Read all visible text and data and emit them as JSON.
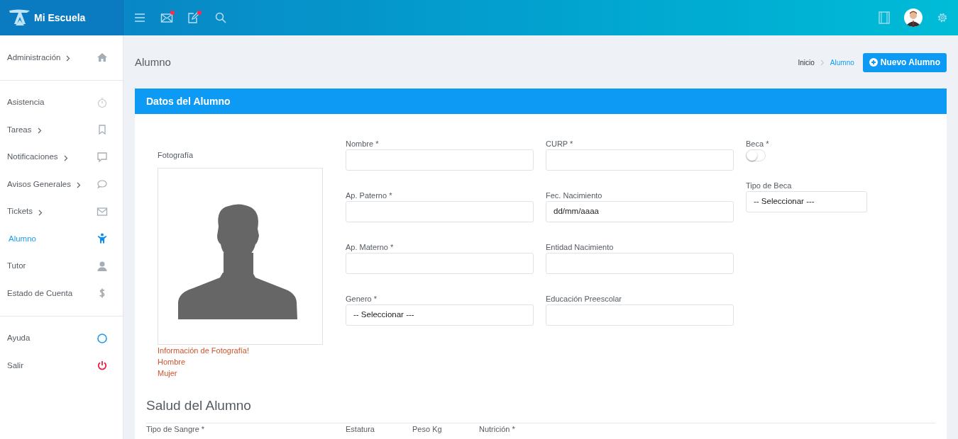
{
  "brand": {
    "name": "Mi Escuela"
  },
  "toolbar": [
    {
      "kind": "menu",
      "badge": false
    },
    {
      "kind": "mail",
      "badge": true
    },
    {
      "kind": "edit",
      "badge": true
    },
    {
      "kind": "search",
      "badge": false
    }
  ],
  "topbar_right": [
    {
      "kind": "film"
    },
    {
      "kind": "avatar"
    },
    {
      "kind": "settings"
    }
  ],
  "sidebar": {
    "sections": [
      {
        "items": [
          {
            "label": "Administración",
            "kind": "home",
            "has_submenu": true,
            "selected": false
          }
        ]
      },
      {
        "items": [
          {
            "label": "Asistencia",
            "kind": "timer",
            "has_submenu": false,
            "selected": false
          },
          {
            "label": "Tareas",
            "kind": "bookmark",
            "has_submenu": true,
            "selected": false
          },
          {
            "label": "Notificaciones",
            "kind": "message",
            "has_submenu": true,
            "selected": false
          },
          {
            "label": "Avisos Generales",
            "kind": "chat",
            "has_submenu": true,
            "selected": false
          },
          {
            "label": "Tickets",
            "kind": "mail",
            "has_submenu": true,
            "selected": false
          },
          {
            "label": "Alumno",
            "kind": "child",
            "has_submenu": false,
            "selected": true
          },
          {
            "label": "Tutor",
            "kind": "user",
            "has_submenu": false,
            "selected": false
          },
          {
            "label": "Estado de Cuenta",
            "kind": "dollar",
            "has_submenu": false,
            "selected": false
          }
        ]
      },
      {
        "items": [
          {
            "label": "Ayuda",
            "kind": "circle",
            "has_submenu": false,
            "selected": false
          },
          {
            "label": "Salir",
            "kind": "power",
            "has_submenu": false,
            "selected": false
          }
        ]
      }
    ]
  },
  "page": {
    "title": "Alumno",
    "breadcrumb": [
      {
        "label": "Inicio",
        "selected": false
      },
      {
        "label": "Alumno",
        "selected": true
      }
    ],
    "action_button": "Nuevo Alumno"
  },
  "card": {
    "title": "Datos del Alumno",
    "photo": {
      "label": "Fotografía",
      "notes": [
        "Información de Fotografía!",
        "Hombre",
        "Mujer"
      ]
    },
    "columns": [
      [
        {
          "label": "Nombre *",
          "kind": "text"
        },
        {
          "label": "Ap. Paterno *",
          "kind": "text"
        },
        {
          "label": "Ap. Materno *",
          "kind": "text"
        },
        {
          "label": "Genero *",
          "kind": "select",
          "value": "-- Seleccionar ---"
        }
      ],
      [
        {
          "label": "CURP *",
          "kind": "text"
        },
        {
          "label": "Fec. Nacimiento",
          "kind": "date",
          "value": "dd/mm/aaaa"
        },
        {
          "label": "Entidad Nacimiento",
          "kind": "text"
        },
        {
          "label": "Educación Preescolar",
          "kind": "text"
        }
      ],
      [
        {
          "label": "Beca *",
          "kind": "toggle",
          "on": false
        },
        {
          "label": "Tipo de Beca",
          "kind": "select",
          "value": "-- Seleccionar ---"
        }
      ]
    ]
  },
  "health": {
    "title": "Salud del Alumno",
    "fields": [
      {
        "label": "Tipo de Sangre *"
      },
      {
        "label": "Estatura"
      },
      {
        "label": "Peso Kg"
      },
      {
        "label": "Nutrición *"
      }
    ]
  }
}
